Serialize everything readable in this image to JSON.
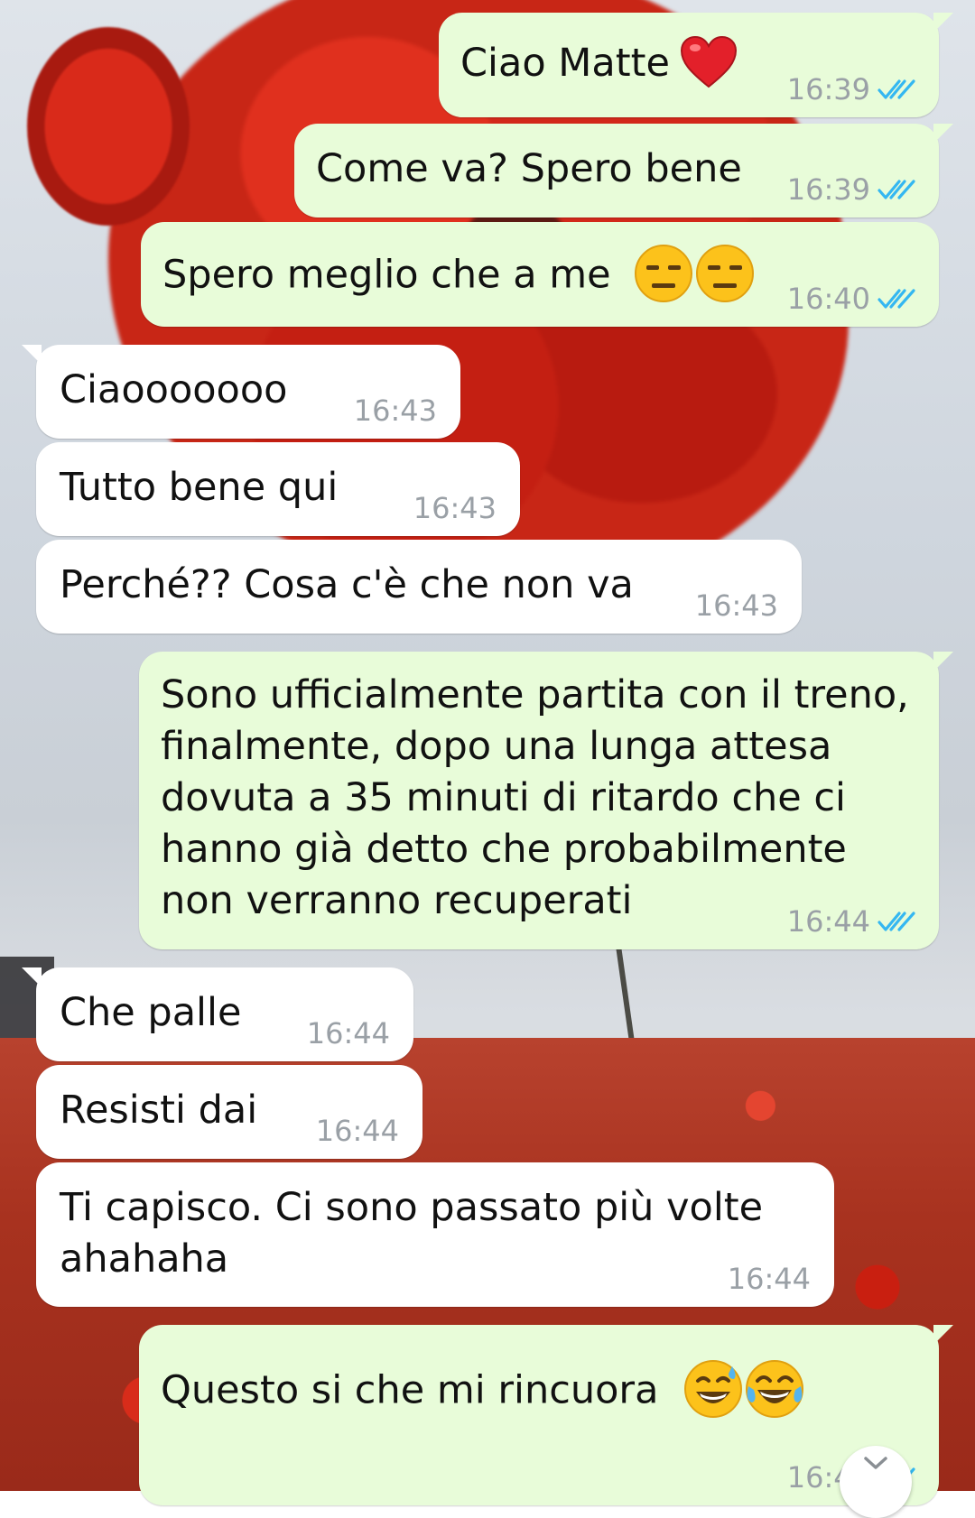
{
  "messages": [
    {
      "direction": "out",
      "text": "Ciao Matte",
      "emoji": [
        "red-heart"
      ],
      "time": "16:39",
      "status": "read"
    },
    {
      "direction": "out",
      "text": "Come va? Spero bene",
      "time": "16:39",
      "status": "read"
    },
    {
      "direction": "out",
      "text": "Spero meglio che a me",
      "emoji": [
        "expressionless-face",
        "expressionless-face"
      ],
      "time": "16:40",
      "status": "read"
    },
    {
      "direction": "in",
      "text": "Ciaooooooo",
      "time": "16:43"
    },
    {
      "direction": "in",
      "text": "Tutto bene qui",
      "time": "16:43"
    },
    {
      "direction": "in",
      "text": "Perché?? Cosa c'è che non va",
      "time": "16:43"
    },
    {
      "direction": "out",
      "lines": [
        "Sono ufficialmente partita con il treno,",
        "finalmente, dopo una lunga attesa",
        "dovuta a 35 minuti di ritardo che ci",
        "hanno già detto che probabilmente",
        "non verranno recuperati"
      ],
      "time": "16:44",
      "status": "read"
    },
    {
      "direction": "in",
      "text": "Che palle",
      "time": "16:44"
    },
    {
      "direction": "in",
      "text": "Resisti dai",
      "time": "16:44"
    },
    {
      "direction": "in",
      "lines": [
        "Ti capisco. Ci sono passato più volte",
        "ahahaha"
      ],
      "time": "16:44"
    },
    {
      "direction": "out",
      "text": "Questo si che mi rincuora",
      "emoji": [
        "grinning-sweat-face",
        "tears-of-joy-face"
      ],
      "time": "16:44",
      "status": "read"
    }
  ],
  "colors": {
    "outgoing_bubble": "#e8fcd9",
    "incoming_bubble": "#ffffff",
    "timestamp": "#9aa0a6",
    "read_ticks": "#34b7f1"
  },
  "icons": {
    "read_receipt": "double-check-icon",
    "scroll_down": "chevron-down-icon"
  }
}
